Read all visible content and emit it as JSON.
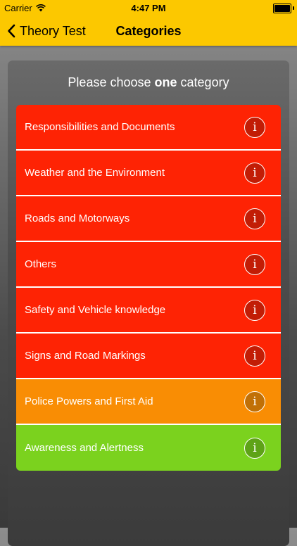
{
  "status_bar": {
    "carrier": "Carrier",
    "time": "4:47 PM"
  },
  "nav": {
    "back_label": "Theory Test",
    "title": "Categories"
  },
  "prompt": {
    "before": "Please choose ",
    "emphasis": "one",
    "after": " category"
  },
  "categories": [
    {
      "label": "Responsibilities and Documents",
      "color": "#fe2304",
      "info_color": "#c21d06",
      "info_glyph": "i"
    },
    {
      "label": "Weather and the Environment",
      "color": "#fe2304",
      "info_color": "#c21d06",
      "info_glyph": "i"
    },
    {
      "label": "Roads and Motorways",
      "color": "#fe2304",
      "info_color": "#c21d06",
      "info_glyph": "i"
    },
    {
      "label": "Others",
      "color": "#fe2304",
      "info_color": "#c21d06",
      "info_glyph": "i"
    },
    {
      "label": "Safety and Vehicle knowledge",
      "color": "#fe2304",
      "info_color": "#c21d06",
      "info_glyph": "i"
    },
    {
      "label": "Signs and Road Markings",
      "color": "#fe2304",
      "info_color": "#c21d06",
      "info_glyph": "i"
    },
    {
      "label": "Police Powers and First Aid",
      "color": "#f98d04",
      "info_color": "#c17006",
      "info_glyph": "i"
    },
    {
      "label": "Awareness and Alertness",
      "color": "#7bd21e",
      "info_color": "#5ea317",
      "info_glyph": "i"
    }
  ],
  "colors": {
    "header": "#fcc800"
  },
  "icons": {
    "back": "chevron-left-icon",
    "wifi": "wifi-icon",
    "battery": "battery-icon",
    "info": "info-icon"
  }
}
